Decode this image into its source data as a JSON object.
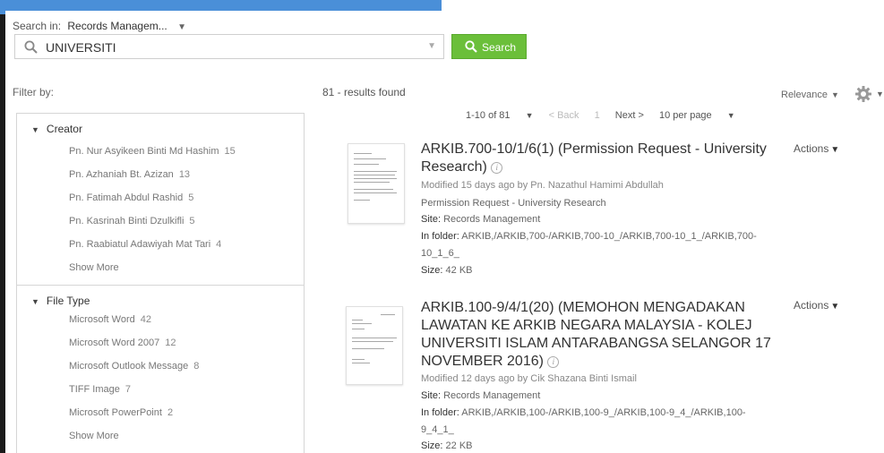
{
  "search": {
    "search_in_label": "Search in:",
    "search_in_value": "Records Managem...",
    "query": "UNIVERSITI",
    "button_label": "Search"
  },
  "filters": {
    "label": "Filter by:",
    "creator": {
      "title": "Creator",
      "items": [
        {
          "name": "Pn. Nur Asyikeen Binti Md Hashim",
          "count": "15"
        },
        {
          "name": "Pn. Azhaniah Bt. Azizan",
          "count": "13"
        },
        {
          "name": "Pn. Fatimah Abdul Rashid",
          "count": "5"
        },
        {
          "name": "Pn. Kasrinah Binti Dzulkifli",
          "count": "5"
        },
        {
          "name": "Pn. Raabiatul Adawiyah Mat Tari",
          "count": "4"
        }
      ],
      "show_more": "Show More"
    },
    "file_type": {
      "title": "File Type",
      "items": [
        {
          "name": "Microsoft Word",
          "count": "42"
        },
        {
          "name": "Microsoft Word 2007",
          "count": "12"
        },
        {
          "name": "Microsoft Outlook Message",
          "count": "8"
        },
        {
          "name": "TIFF Image",
          "count": "7"
        },
        {
          "name": "Microsoft PowerPoint",
          "count": "2"
        }
      ],
      "show_more": "Show More"
    }
  },
  "results": {
    "count_text": "81 - results found",
    "sort_label": "Relevance",
    "pager": {
      "range": "1-10 of 81",
      "back": "< Back",
      "page": "1",
      "next": "Next >",
      "per_page": "10 per page"
    },
    "items": [
      {
        "title": "ARKIB.700-10/1/6(1) (Permission Request - University Research)",
        "modified": "Modified 15 days ago by Pn. Nazathul Hamimi Abdullah",
        "description": "Permission Request - University Research",
        "site_label": "Site:",
        "site": "Records Management",
        "folder_label": "In folder:",
        "folder_line1": "ARKIB,/ARKIB,700-/ARKIB,700-10_/ARKIB,700-10_1_/ARKIB,700-",
        "folder_line2": "10_1_6_",
        "size_label": "Size:",
        "size": "42 KB",
        "actions": "Actions"
      },
      {
        "title": "ARKIB.100-9/4/1(20) (MEMOHON MENGADAKAN LAWATAN KE ARKIB NEGARA MALAYSIA - KOLEJ UNIVERSITI ISLAM ANTARABANGSA SELANGOR 17 NOVEMBER 2016)",
        "modified": "Modified 12 days ago by Cik Shazana Binti Ismail",
        "site_label": "Site:",
        "site": "Records Management",
        "folder_label": "In folder:",
        "folder_line1": "ARKIB,/ARKIB,100-/ARKIB,100-9_/ARKIB,100-9_4_/ARKIB,100-",
        "folder_line2": "9_4_1_",
        "size_label": "Size:",
        "size": "22 KB",
        "actions": "Actions"
      }
    ]
  },
  "colors": {
    "accent_green": "#6bbf3a",
    "top_strip_blue": "#4a8fd8",
    "frame_dark": "#1b1b1b"
  },
  "icons": [
    "search-icon",
    "caret-down-icon",
    "triangle-down-icon",
    "info-icon",
    "gear-icon"
  ]
}
